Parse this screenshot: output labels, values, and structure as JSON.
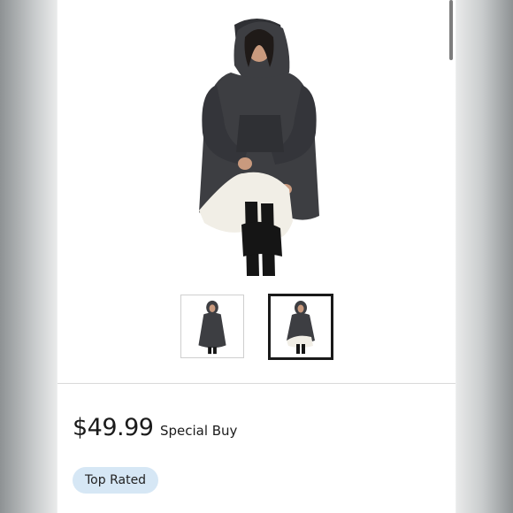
{
  "product": {
    "main_image": "hooded-blanket-sweatshirt-photo",
    "thumbnails": [
      {
        "name": "front-view",
        "selected": false
      },
      {
        "name": "lifted-hem-view",
        "selected": true
      }
    ]
  },
  "pricing": {
    "price": "$49.99",
    "label": "Special Buy"
  },
  "badge": {
    "text": "Top Rated"
  },
  "colors": {
    "garment": "#3d3e42",
    "lining": "#f1eee6",
    "badge_bg": "#d6e7f5",
    "selected_border": "#1a1a1a"
  }
}
